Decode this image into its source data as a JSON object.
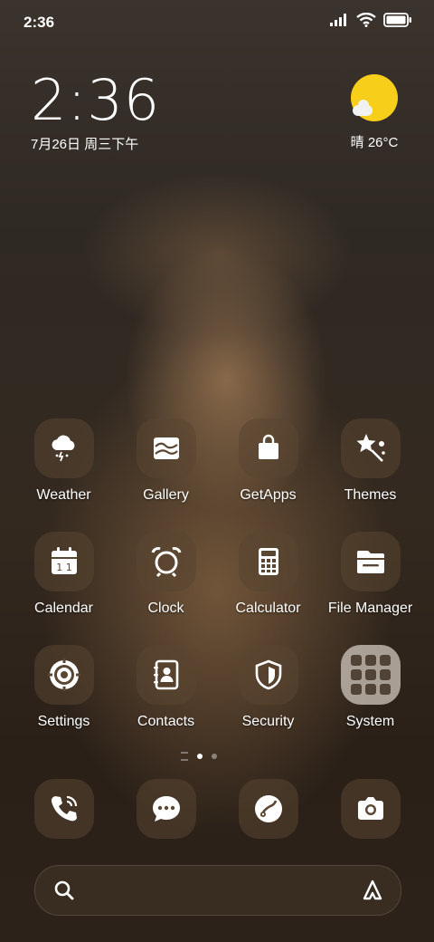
{
  "status": {
    "time": "2:36",
    "icons": [
      "signal-icon",
      "wifi-icon",
      "battery-icon"
    ]
  },
  "clock_widget": {
    "time": "2:36",
    "date": "7月26日 周三下午"
  },
  "weather_widget": {
    "icon": "sunny-cloud-icon",
    "text": "晴 26°C"
  },
  "apps": {
    "row1": [
      {
        "label": "Weather",
        "icon": "weather-icon"
      },
      {
        "label": "Gallery",
        "icon": "gallery-icon"
      },
      {
        "label": "GetApps",
        "icon": "shopping-bag-icon"
      },
      {
        "label": "Themes",
        "icon": "themes-star-icon"
      }
    ],
    "row2": [
      {
        "label": "Calendar",
        "icon": "calendar-icon"
      },
      {
        "label": "Clock",
        "icon": "alarm-clock-icon"
      },
      {
        "label": "Calculator",
        "icon": "calculator-icon"
      },
      {
        "label": "File Manager",
        "icon": "folder-icon"
      }
    ],
    "row3": [
      {
        "label": "Settings",
        "icon": "settings-icon"
      },
      {
        "label": "Contacts",
        "icon": "contacts-icon"
      },
      {
        "label": "Security",
        "icon": "shield-icon"
      },
      {
        "label": "System",
        "icon": "folder-apps-icon"
      }
    ]
  },
  "dock": [
    {
      "icon": "phone-icon"
    },
    {
      "icon": "messages-icon"
    },
    {
      "icon": "browser-icon"
    },
    {
      "icon": "camera-icon"
    }
  ],
  "page_indicator": {
    "current": 1,
    "total": 2
  },
  "colors": {
    "sun": "#f7cf1a",
    "folder_bg": "#d2c8be"
  }
}
